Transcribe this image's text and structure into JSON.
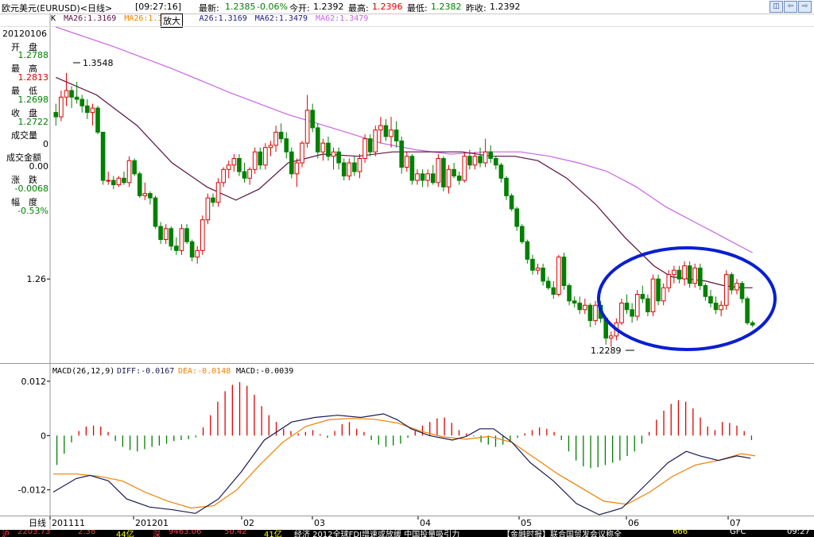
{
  "window": {
    "symbol_title": "欧元美元(EURUSD)<日线>",
    "time": "[09:27:16]",
    "latest_label": "最新:",
    "latest_value": "1.2385",
    "change": "-0.06%",
    "open_label": "今开:",
    "open_value": "1.2392",
    "high_label": "最高:",
    "high_value": "1.2396",
    "low_label": "最低:",
    "low_value": "1.2382",
    "prevclose_label": "昨收:",
    "prevclose_value": "1.2392",
    "buttons": [
      "◫",
      "⇦",
      "⇨"
    ]
  },
  "legend": {
    "k": "K",
    "ma26_black": "MA26:1.3169",
    "ma26_orange": "MA26:1.3",
    "zoom": "放大",
    "ma26_blue": "A26:1.3169",
    "ma62_blue": "MA62:1.3479",
    "ma62_pink": "MA62:1.3479"
  },
  "sidebar": {
    "date": "20120106",
    "open_label": "开　盘",
    "open_value": "1.2788",
    "high_label": "最　高",
    "high_value": "1.2813",
    "low_label": "最　低",
    "low_value": "1.2698",
    "close_label": "收　盘",
    "close_value": "1.2722",
    "volume_label": "成交量",
    "volume_value": "0",
    "amount_label": "成交金额",
    "amount_value": "0.00",
    "change_label": "涨　跌",
    "change_value": "-0.0068",
    "amplitude_label": "幅　度",
    "amplitude_value": "-0.53%"
  },
  "macd_legend": {
    "name": "MACD(26,12,9)",
    "diff": "DIFF:-0.0167",
    "dea": "DEA:-0.0148",
    "macd": "MACD:-0.0039"
  },
  "statusbar": {
    "items": [
      "沪",
      "2203.73",
      "2.38",
      "44亿",
      "深",
      "9463.06",
      "50.42",
      "41亿",
      "经济 2012全球FDI增速或放缓 中国投量吸引力",
      "【金融时报】联合国贸发会议称全",
      "666",
      "GFC",
      "09:27"
    ]
  },
  "colors": {
    "up": "#e00000",
    "down": "#008000",
    "ma_main": "#5a1040",
    "ma_long": "#c864e6",
    "diff_line": "#1a1a50",
    "dea_line": "#f08000",
    "highlight_ellipse": "#0a1fd0"
  },
  "chart_data": {
    "type": "candlestick",
    "price_axis": {
      "ticks": [
        1.26
      ],
      "range": [
        1.222,
        1.375
      ]
    },
    "macd_axis": {
      "ticks": [
        0.012,
        0,
        -0.012
      ],
      "range": [
        -0.0175,
        0.0155
      ]
    },
    "x_tick_labels": [
      "日线",
      "201111",
      "201201",
      "02",
      "03",
      "04",
      "05",
      "06",
      "07"
    ],
    "annotations": {
      "max_label": "1.3548",
      "min_label": "1.2289"
    },
    "candles_ohlc": [
      [
        1.336,
        1.34,
        1.33,
        1.334
      ],
      [
        1.334,
        1.346,
        1.332,
        1.343
      ],
      [
        1.343,
        1.354,
        1.339,
        1.346
      ],
      [
        1.346,
        1.348,
        1.338,
        1.343
      ],
      [
        1.343,
        1.35,
        1.34,
        1.342
      ],
      [
        1.342,
        1.344,
        1.336,
        1.339
      ],
      [
        1.339,
        1.342,
        1.333,
        1.336
      ],
      [
        1.336,
        1.34,
        1.33,
        1.338
      ],
      [
        1.338,
        1.339,
        1.326,
        1.327
      ],
      [
        1.327,
        1.319,
        1.303,
        1.305
      ],
      [
        1.305,
        1.309,
        1.303,
        1.305
      ],
      [
        1.305,
        1.307,
        1.301,
        1.303
      ],
      [
        1.303,
        1.307,
        1.302,
        1.306
      ],
      [
        1.306,
        1.309,
        1.303,
        1.304
      ],
      [
        1.304,
        1.316,
        1.302,
        1.314
      ],
      [
        1.314,
        1.315,
        1.307,
        1.308
      ],
      [
        1.308,
        1.309,
        1.297,
        1.298
      ],
      [
        1.298,
        1.304,
        1.296,
        1.299
      ],
      [
        1.299,
        1.3,
        1.294,
        1.297
      ],
      [
        1.297,
        1.298,
        1.283,
        1.284
      ],
      [
        1.284,
        1.286,
        1.276,
        1.278
      ],
      [
        1.278,
        1.285,
        1.276,
        1.283
      ],
      [
        1.283,
        1.284,
        1.273,
        1.275
      ],
      [
        1.275,
        1.279,
        1.271,
        1.273
      ],
      [
        1.273,
        1.285,
        1.271,
        1.283
      ],
      [
        1.283,
        1.285,
        1.276,
        1.277
      ],
      [
        1.277,
        1.278,
        1.268,
        1.27
      ],
      [
        1.27,
        1.275,
        1.267,
        1.273
      ],
      [
        1.273,
        1.289,
        1.271,
        1.287
      ],
      [
        1.287,
        1.299,
        1.285,
        1.297
      ],
      [
        1.297,
        1.299,
        1.293,
        1.295
      ],
      [
        1.295,
        1.306,
        1.293,
        1.304
      ],
      [
        1.304,
        1.311,
        1.302,
        1.31
      ],
      [
        1.31,
        1.314,
        1.306,
        1.312
      ],
      [
        1.312,
        1.317,
        1.309,
        1.315
      ],
      [
        1.315,
        1.317,
        1.307,
        1.309
      ],
      [
        1.309,
        1.313,
        1.304,
        1.306
      ],
      [
        1.306,
        1.311,
        1.303,
        1.31
      ],
      [
        1.31,
        1.32,
        1.308,
        1.318
      ],
      [
        1.318,
        1.32,
        1.31,
        1.312
      ],
      [
        1.312,
        1.322,
        1.31,
        1.32
      ],
      [
        1.32,
        1.323,
        1.316,
        1.321
      ],
      [
        1.321,
        1.33,
        1.318,
        1.327
      ],
      [
        1.327,
        1.331,
        1.322,
        1.324
      ],
      [
        1.324,
        1.327,
        1.315,
        1.318
      ],
      [
        1.318,
        1.32,
        1.306,
        1.308
      ],
      [
        1.308,
        1.315,
        1.302,
        1.313
      ],
      [
        1.313,
        1.323,
        1.311,
        1.322
      ],
      [
        1.322,
        1.344,
        1.32,
        1.337
      ],
      [
        1.337,
        1.34,
        1.327,
        1.329
      ],
      [
        1.329,
        1.331,
        1.315,
        1.318
      ],
      [
        1.318,
        1.324,
        1.314,
        1.322
      ],
      [
        1.322,
        1.325,
        1.314,
        1.316
      ],
      [
        1.316,
        1.32,
        1.31,
        1.318
      ],
      [
        1.318,
        1.32,
        1.31,
        1.313
      ],
      [
        1.313,
        1.315,
        1.305,
        1.307
      ],
      [
        1.307,
        1.315,
        1.305,
        1.313
      ],
      [
        1.313,
        1.316,
        1.307,
        1.309
      ],
      [
        1.309,
        1.317,
        1.306,
        1.315
      ],
      [
        1.315,
        1.326,
        1.313,
        1.324
      ],
      [
        1.324,
        1.326,
        1.316,
        1.318
      ],
      [
        1.318,
        1.33,
        1.316,
        1.328
      ],
      [
        1.328,
        1.334,
        1.322,
        1.33
      ],
      [
        1.33,
        1.333,
        1.323,
        1.325
      ],
      [
        1.325,
        1.334,
        1.32,
        1.328
      ],
      [
        1.328,
        1.332,
        1.32,
        1.323
      ],
      [
        1.323,
        1.325,
        1.308,
        1.311
      ],
      [
        1.311,
        1.318,
        1.309,
        1.316
      ],
      [
        1.316,
        1.317,
        1.303,
        1.305
      ],
      [
        1.305,
        1.31,
        1.303,
        1.308
      ],
      [
        1.308,
        1.31,
        1.302,
        1.305
      ],
      [
        1.305,
        1.31,
        1.302,
        1.308
      ],
      [
        1.308,
        1.312,
        1.303,
        1.304
      ],
      [
        1.304,
        1.317,
        1.302,
        1.315
      ],
      [
        1.315,
        1.316,
        1.3,
        1.302
      ],
      [
        1.302,
        1.312,
        1.299,
        1.31
      ],
      [
        1.31,
        1.313,
        1.306,
        1.307
      ],
      [
        1.307,
        1.309,
        1.303,
        1.305
      ],
      [
        1.305,
        1.318,
        1.304,
        1.316
      ],
      [
        1.316,
        1.319,
        1.31,
        1.312
      ],
      [
        1.312,
        1.318,
        1.31,
        1.316
      ],
      [
        1.316,
        1.32,
        1.311,
        1.313
      ],
      [
        1.313,
        1.324,
        1.311,
        1.318
      ],
      [
        1.318,
        1.321,
        1.313,
        1.315
      ],
      [
        1.315,
        1.316,
        1.31,
        1.312
      ],
      [
        1.312,
        1.313,
        1.304,
        1.306
      ],
      [
        1.306,
        1.307,
        1.296,
        1.298
      ],
      [
        1.298,
        1.299,
        1.291,
        1.292
      ],
      [
        1.292,
        1.293,
        1.282,
        1.284
      ],
      [
        1.284,
        1.285,
        1.276,
        1.277
      ],
      [
        1.277,
        1.278,
        1.267,
        1.269
      ],
      [
        1.269,
        1.271,
        1.262,
        1.264
      ],
      [
        1.264,
        1.267,
        1.262,
        1.265
      ],
      [
        1.265,
        1.267,
        1.257,
        1.259
      ],
      [
        1.259,
        1.261,
        1.255,
        1.256
      ],
      [
        1.256,
        1.259,
        1.251,
        1.253
      ],
      [
        1.253,
        1.271,
        1.252,
        1.27
      ],
      [
        1.27,
        1.272,
        1.255,
        1.257
      ],
      [
        1.257,
        1.258,
        1.248,
        1.25
      ],
      [
        1.25,
        1.252,
        1.247,
        1.249
      ],
      [
        1.249,
        1.252,
        1.244,
        1.246
      ],
      [
        1.246,
        1.251,
        1.244,
        1.248
      ],
      [
        1.248,
        1.249,
        1.238,
        1.241
      ],
      [
        1.241,
        1.25,
        1.239,
        1.248
      ],
      [
        1.248,
        1.25,
        1.24,
        1.242
      ],
      [
        1.242,
        1.243,
        1.23,
        1.233
      ],
      [
        1.233,
        1.236,
        1.229,
        1.234
      ],
      [
        1.234,
        1.242,
        1.232,
        1.24
      ],
      [
        1.24,
        1.251,
        1.239,
        1.249
      ],
      [
        1.249,
        1.253,
        1.244,
        1.246
      ],
      [
        1.246,
        1.249,
        1.24,
        1.243
      ],
      [
        1.243,
        1.255,
        1.241,
        1.253
      ],
      [
        1.253,
        1.257,
        1.249,
        1.251
      ],
      [
        1.251,
        1.253,
        1.243,
        1.245
      ],
      [
        1.245,
        1.262,
        1.243,
        1.26
      ],
      [
        1.26,
        1.262,
        1.248,
        1.25
      ],
      [
        1.25,
        1.258,
        1.248,
        1.256
      ],
      [
        1.256,
        1.264,
        1.254,
        1.262
      ],
      [
        1.262,
        1.266,
        1.258,
        1.264
      ],
      [
        1.264,
        1.266,
        1.258,
        1.26
      ],
      [
        1.26,
        1.268,
        1.257,
        1.266
      ],
      [
        1.266,
        1.268,
        1.256,
        1.258
      ],
      [
        1.258,
        1.267,
        1.256,
        1.265
      ],
      [
        1.265,
        1.267,
        1.255,
        1.257
      ],
      [
        1.257,
        1.258,
        1.25,
        1.252
      ],
      [
        1.252,
        1.255,
        1.247,
        1.249
      ],
      [
        1.249,
        1.252,
        1.244,
        1.246
      ],
      [
        1.246,
        1.25,
        1.243,
        1.248
      ],
      [
        1.248,
        1.264,
        1.246,
        1.262
      ],
      [
        1.262,
        1.263,
        1.253,
        1.255
      ],
      [
        1.255,
        1.26,
        1.253,
        1.258
      ],
      [
        1.258,
        1.259,
        1.249,
        1.251
      ],
      [
        1.251,
        1.252,
        1.239,
        1.24
      ],
      [
        1.24,
        1.241,
        1.238,
        1.239
      ]
    ],
    "ma_main": [
      [
        0,
        1.352
      ],
      [
        14,
        1.344
      ],
      [
        28,
        1.33
      ],
      [
        40,
        1.313
      ],
      [
        52,
        1.302
      ],
      [
        62,
        1.296
      ],
      [
        70,
        1.301
      ],
      [
        80,
        1.313
      ],
      [
        92,
        1.317
      ],
      [
        104,
        1.316
      ],
      [
        116,
        1.318
      ],
      [
        128,
        1.318
      ],
      [
        140,
        1.318
      ],
      [
        150,
        1.316
      ],
      [
        158,
        1.316
      ],
      [
        166,
        1.314
      ],
      [
        176,
        1.306
      ],
      [
        186,
        1.294
      ],
      [
        196,
        1.279
      ],
      [
        206,
        1.266
      ],
      [
        212,
        1.261
      ],
      [
        218,
        1.26
      ],
      [
        224,
        1.259
      ],
      [
        230,
        1.257
      ],
      [
        236,
        1.256
      ],
      [
        240,
        1.256
      ]
    ],
    "ma_long": [
      [
        0,
        1.375
      ],
      [
        20,
        1.366
      ],
      [
        40,
        1.356
      ],
      [
        60,
        1.345
      ],
      [
        80,
        1.335
      ],
      [
        100,
        1.327
      ],
      [
        112,
        1.322
      ],
      [
        124,
        1.319
      ],
      [
        136,
        1.317
      ],
      [
        148,
        1.318
      ],
      [
        160,
        1.318
      ],
      [
        170,
        1.316
      ],
      [
        180,
        1.313
      ],
      [
        190,
        1.309
      ],
      [
        200,
        1.302
      ],
      [
        210,
        1.293
      ],
      [
        220,
        1.286
      ],
      [
        230,
        1.279
      ],
      [
        240,
        1.272
      ]
    ],
    "macd_diff": [
      [
        0,
        -0.0125
      ],
      [
        10,
        -0.0095
      ],
      [
        16,
        -0.0088
      ],
      [
        24,
        -0.01
      ],
      [
        32,
        -0.014
      ],
      [
        42,
        -0.0158
      ],
      [
        52,
        -0.0164
      ],
      [
        62,
        -0.0172
      ],
      [
        72,
        -0.014
      ],
      [
        82,
        -0.008
      ],
      [
        92,
        -0.001
      ],
      [
        104,
        0.003
      ],
      [
        114,
        0.004
      ],
      [
        124,
        0.0045
      ],
      [
        134,
        0.004
      ],
      [
        144,
        0.0048
      ],
      [
        150,
        0.0035
      ],
      [
        156,
        0.0015
      ],
      [
        164,
        0.0
      ],
      [
        174,
        -0.001
      ],
      [
        180,
        -0.0002
      ],
      [
        186,
        0.0015
      ],
      [
        192,
        0.0015
      ],
      [
        200,
        -0.0015
      ],
      [
        208,
        -0.006
      ],
      [
        218,
        -0.01
      ],
      [
        228,
        -0.015
      ],
      [
        238,
        -0.0175
      ],
      [
        248,
        -0.016
      ],
      [
        258,
        -0.011
      ],
      [
        268,
        -0.006
      ],
      [
        276,
        -0.0035
      ],
      [
        282,
        -0.0045
      ],
      [
        290,
        -0.0055
      ],
      [
        298,
        -0.0045
      ],
      [
        304,
        -0.005
      ]
    ],
    "macd_dea": [
      [
        0,
        -0.0085
      ],
      [
        10,
        -0.0085
      ],
      [
        20,
        -0.009
      ],
      [
        30,
        -0.01
      ],
      [
        40,
        -0.0125
      ],
      [
        50,
        -0.0145
      ],
      [
        60,
        -0.016
      ],
      [
        70,
        -0.0155
      ],
      [
        80,
        -0.012
      ],
      [
        90,
        -0.0065
      ],
      [
        100,
        -0.0015
      ],
      [
        110,
        0.002
      ],
      [
        120,
        0.0035
      ],
      [
        130,
        0.0038
      ],
      [
        140,
        0.0036
      ],
      [
        150,
        0.0028
      ],
      [
        160,
        0.001
      ],
      [
        170,
        -0.0003
      ],
      [
        180,
        -0.0008
      ],
      [
        190,
        -0.0002
      ],
      [
        200,
        -0.0015
      ],
      [
        210,
        -0.005
      ],
      [
        220,
        -0.0085
      ],
      [
        230,
        -0.0115
      ],
      [
        240,
        -0.0145
      ],
      [
        250,
        -0.0152
      ],
      [
        260,
        -0.0125
      ],
      [
        270,
        -0.009
      ],
      [
        280,
        -0.0065
      ],
      [
        290,
        -0.0055
      ],
      [
        300,
        -0.004
      ],
      [
        306,
        -0.0045
      ]
    ],
    "macd_histogram": [
      -0.0065,
      -0.004,
      -0.0015,
      0.001,
      0.002,
      0.0022,
      0.002,
      0.0008,
      -0.0012,
      -0.0025,
      -0.0032,
      -0.0035,
      -0.003,
      -0.0025,
      -0.0022,
      -0.0018,
      -0.0012,
      -0.001,
      -0.0008,
      -0.0004,
      0.0018,
      0.0045,
      0.0075,
      0.0098,
      0.0112,
      0.0118,
      0.011,
      0.009,
      0.0065,
      0.0045,
      0.003,
      0.0015,
      0.001,
      0.0005,
      0.0008,
      0.0012,
      0.0003,
      -0.0005,
      0.001,
      0.0025,
      0.003,
      0.0015,
      0.0008,
      -0.001,
      -0.002,
      -0.0025,
      -0.0022,
      -0.0018,
      -0.0005,
      0.001,
      0.0022,
      0.003,
      0.0038,
      0.004,
      0.0028,
      0.0012,
      0.0005,
      -0.0002,
      -0.0015,
      -0.002,
      -0.0025,
      -0.002,
      -0.0012,
      -0.0005,
      0.0005,
      0.0012,
      0.0018,
      0.0015,
      0.0008,
      -0.001,
      -0.0035,
      -0.0055,
      -0.0068,
      -0.0072,
      -0.007,
      -0.0065,
      -0.006,
      -0.0055,
      -0.0045,
      -0.0035,
      -0.0018,
      0.0008,
      0.0035,
      0.0055,
      0.007,
      0.0078,
      0.0075,
      0.006,
      0.004,
      0.002,
      0.0012,
      0.003,
      0.0028,
      0.0022,
      0.001,
      -0.001
    ]
  }
}
